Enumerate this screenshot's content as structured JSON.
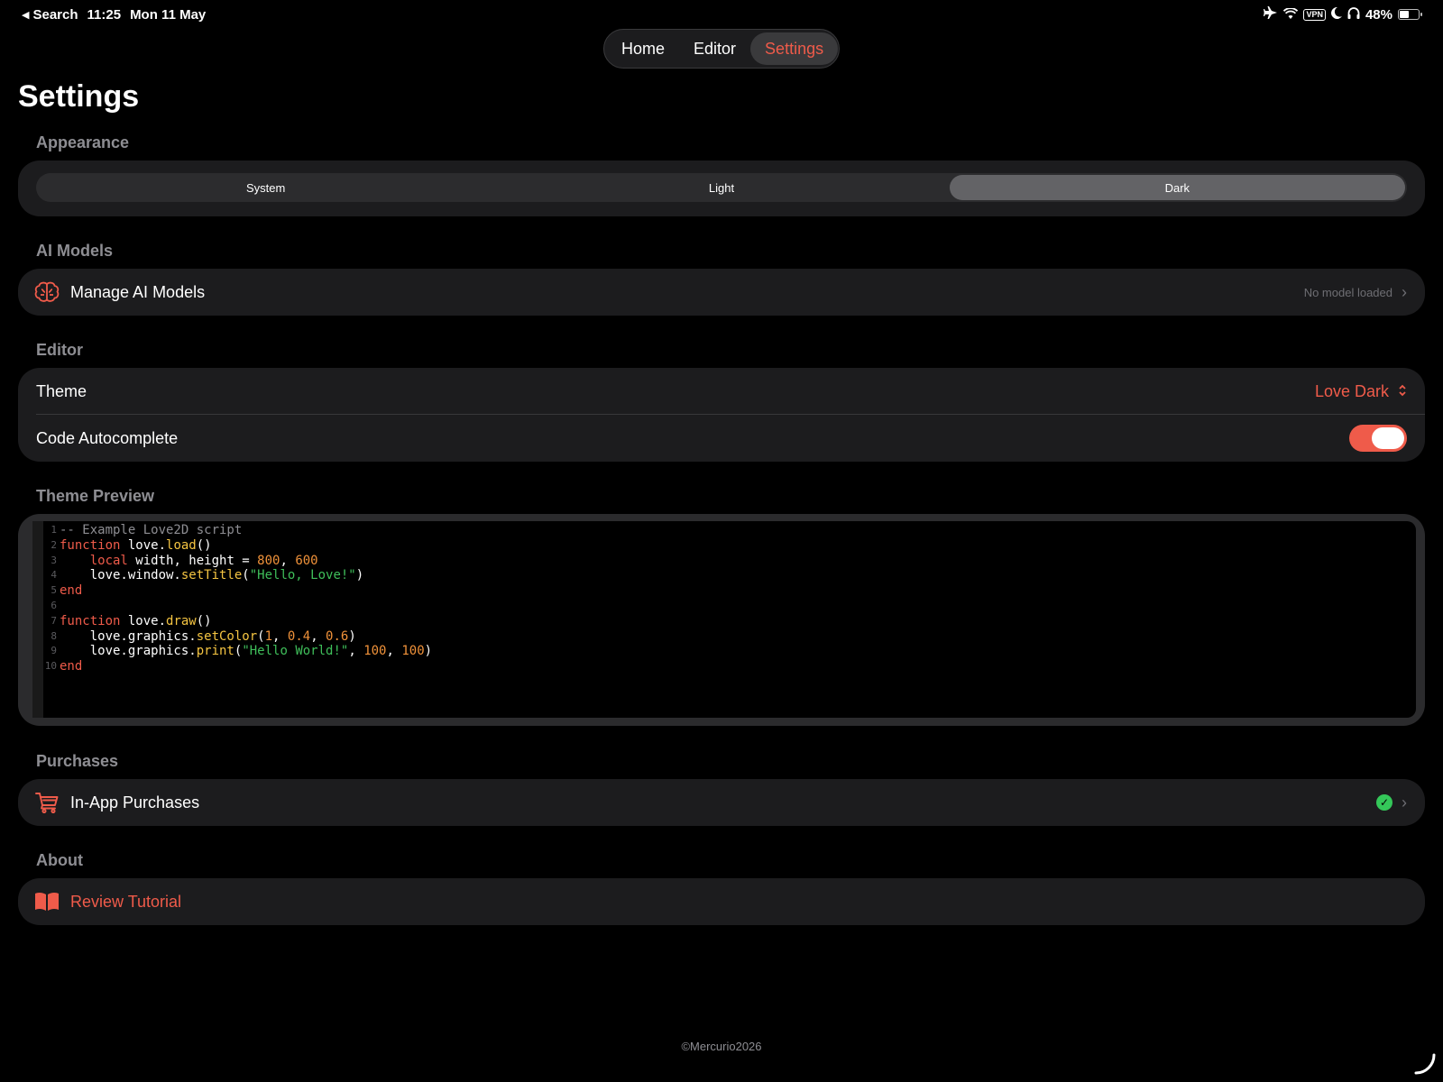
{
  "status_bar": {
    "back_label": "Search",
    "time": "11:25",
    "date": "Mon 11 May",
    "vpn": "VPN",
    "battery": "48%",
    "battery_level": 0.48
  },
  "nav_tabs": [
    {
      "label": "Home",
      "active": false
    },
    {
      "label": "Editor",
      "active": false
    },
    {
      "label": "Settings",
      "active": true
    }
  ],
  "page_title": "Settings",
  "appearance": {
    "header": "Appearance",
    "options": [
      "System",
      "Light",
      "Dark"
    ],
    "selected": "Dark"
  },
  "ai_models": {
    "header": "AI Models",
    "row_label": "Manage AI Models",
    "row_value": "No model loaded",
    "icon": "brain-icon"
  },
  "editor": {
    "header": "Editor",
    "theme_label": "Theme",
    "theme_value": "Love Dark",
    "autocomplete_label": "Code Autocomplete",
    "autocomplete_on": true
  },
  "theme_preview": {
    "header": "Theme Preview",
    "lines": [
      {
        "n": "1",
        "code": "-- Example Love2D script"
      },
      {
        "n": "2",
        "code": "function love.load()"
      },
      {
        "n": "3",
        "code": "    local width, height = 800, 600"
      },
      {
        "n": "4",
        "code": "    love.window.setTitle(\"Hello, Love!\")"
      },
      {
        "n": "5",
        "code": "end"
      },
      {
        "n": "6",
        "code": ""
      },
      {
        "n": "7",
        "code": "function love.draw()"
      },
      {
        "n": "8",
        "code": "    love.graphics.setColor(1, 0.4, 0.6)"
      },
      {
        "n": "9",
        "code": "    love.graphics.print(\"Hello World!\", 100, 100)"
      },
      {
        "n": "10",
        "code": "end"
      }
    ]
  },
  "purchases": {
    "header": "Purchases",
    "row_label": "In-App Purchases",
    "icon": "cart-icon",
    "status": "purchased"
  },
  "about": {
    "header": "About",
    "row_label": "Review Tutorial",
    "icon": "book-icon"
  },
  "footer": "©Mercurio2026",
  "colors": {
    "accent": "#ef5b4a",
    "background": "#000000",
    "card": "#1c1c1e",
    "success": "#34c759"
  }
}
